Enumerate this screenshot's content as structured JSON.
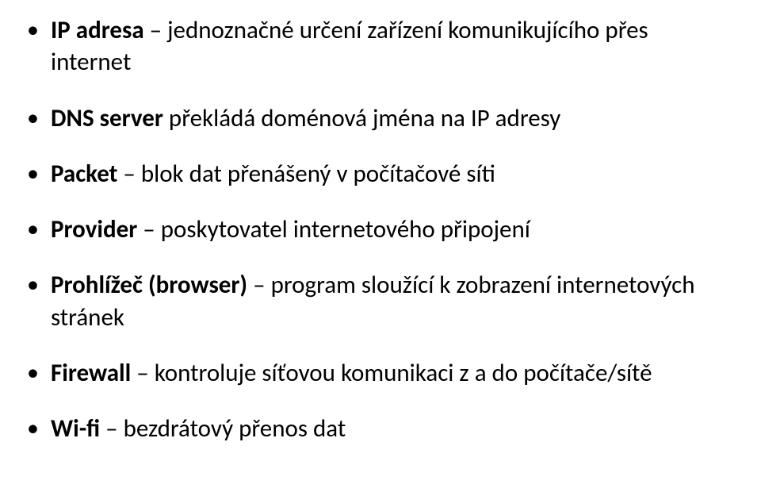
{
  "items": [
    {
      "term": "IP adresa",
      "sep": " – ",
      "def": "jednoznačné určení zařízení komunikujícího přes internet"
    },
    {
      "term": "DNS server",
      "sep": " ",
      "def": "překládá doménová jména na IP adresy"
    },
    {
      "term": "Packet",
      "sep": " – ",
      "def": "blok dat přenášený v počítačové síti"
    },
    {
      "term": "Provider",
      "sep": " – ",
      "def": "poskytovatel internetového připojení"
    },
    {
      "term": "Prohlížeč (browser)",
      "sep": " – ",
      "def": "program sloužící k zobrazení internetových stránek"
    },
    {
      "term": "Firewall",
      "sep": " – ",
      "def": "kontroluje síťovou komunikaci z a do počítače/sítě"
    },
    {
      "term": "Wi-fi",
      "sep": " – ",
      "def": "bezdrátový přenos dat"
    }
  ]
}
